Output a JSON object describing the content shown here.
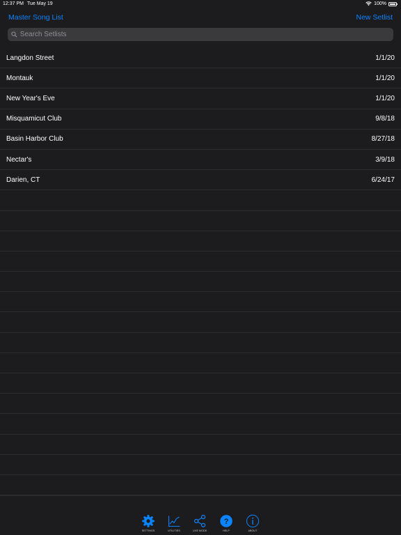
{
  "status": {
    "time": "12:37 PM",
    "date": "Tue May 19",
    "battery": "100%"
  },
  "nav": {
    "left_label": "Master Song List",
    "right_label": "New Setlist"
  },
  "search": {
    "placeholder": "Search Setlists"
  },
  "setlists": [
    {
      "name": "Langdon Street",
      "date": "1/1/20"
    },
    {
      "name": "Montauk",
      "date": "1/1/20"
    },
    {
      "name": "New Year's Eve",
      "date": "1/1/20"
    },
    {
      "name": "Misquamicut Club",
      "date": "9/8/18"
    },
    {
      "name": "Basin Harbor Club",
      "date": "8/27/18"
    },
    {
      "name": "Nectar's",
      "date": "3/9/18"
    },
    {
      "name": "Darien, CT",
      "date": "6/24/17"
    }
  ],
  "toolbar": {
    "settings": "SETTINGS",
    "utilities": "UTILITIES",
    "live_mode": "LIVE MODE",
    "help": "HELP",
    "about": "ABOUT"
  },
  "colors": {
    "accent": "#0a84ff",
    "background": "#1c1c1e",
    "separator": "#2c2c2e"
  }
}
